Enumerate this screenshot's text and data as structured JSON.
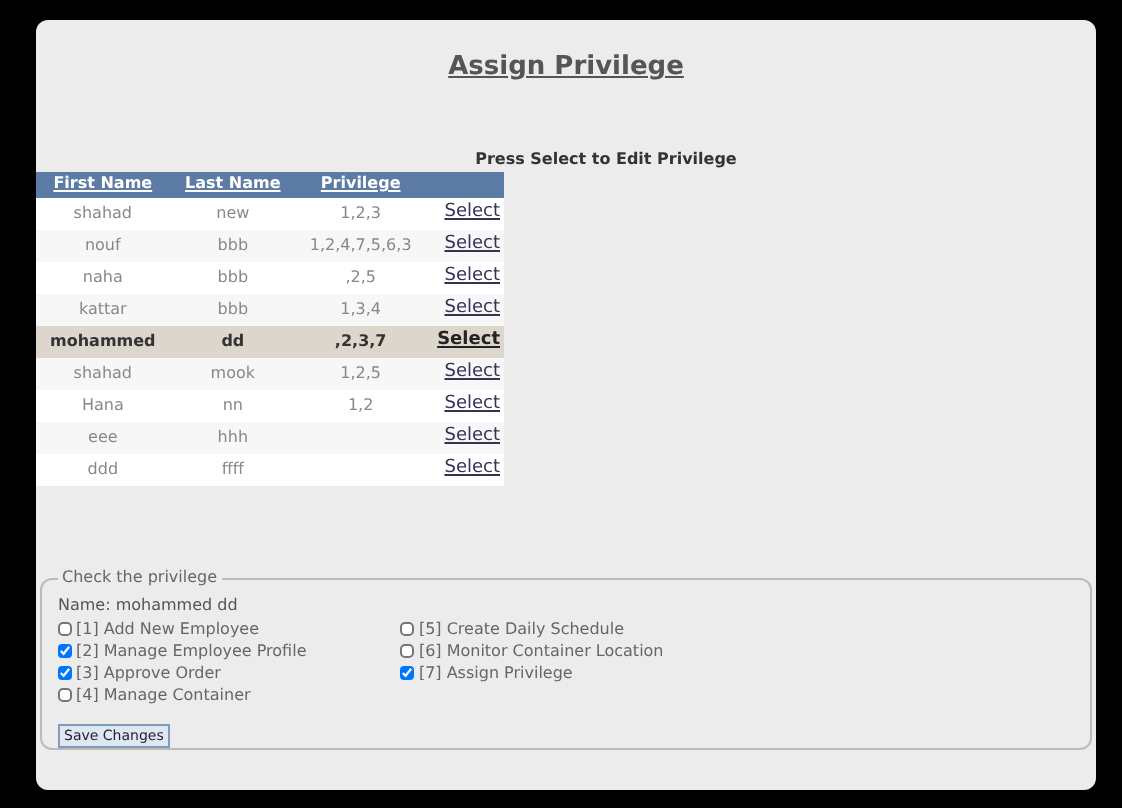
{
  "title": "Assign Privilege",
  "instruction": "Press Select to Edit Privilege",
  "table": {
    "columns": [
      "First Name",
      "Last Name",
      "Privilege"
    ],
    "rows": [
      {
        "first": "shahad",
        "last": "new",
        "privilege": "1,2,3",
        "action": "Select",
        "selected": false
      },
      {
        "first": "nouf",
        "last": "bbb",
        "privilege": "1,2,4,7,5,6,3",
        "action": "Select",
        "selected": false
      },
      {
        "first": "naha",
        "last": "bbb",
        "privilege": ",2,5",
        "action": "Select",
        "selected": false
      },
      {
        "first": "kattar",
        "last": "bbb",
        "privilege": "1,3,4",
        "action": "Select",
        "selected": false
      },
      {
        "first": "mohammed",
        "last": "dd",
        "privilege": ",2,3,7",
        "action": "Select",
        "selected": true
      },
      {
        "first": "shahad",
        "last": "mook",
        "privilege": "1,2,5",
        "action": "Select",
        "selected": false
      },
      {
        "first": "Hana",
        "last": "nn",
        "privilege": "1,2",
        "action": "Select",
        "selected": false
      },
      {
        "first": "eee",
        "last": "hhh",
        "action": "Select",
        "selected": false
      },
      {
        "first": "ddd",
        "last": "ffff",
        "action": "Select",
        "selected": false
      }
    ]
  },
  "privileges": {
    "legend": "Check the privilege",
    "name": "Name: mohammed dd",
    "items": [
      {
        "label": "[1] Add New Employee",
        "checked": false
      },
      {
        "label": "[2] Manage Employee Profile",
        "checked": true
      },
      {
        "label": "[3] Approve Order",
        "checked": true
      },
      {
        "label": "[4] Manage Container",
        "checked": false
      },
      {
        "label": "[5] Create Daily Schedule",
        "checked": false
      },
      {
        "label": "[6] Monitor Container Location",
        "checked": false
      },
      {
        "label": "[7] Assign Privilege",
        "checked": true
      }
    ],
    "button": "Save Changes"
  }
}
